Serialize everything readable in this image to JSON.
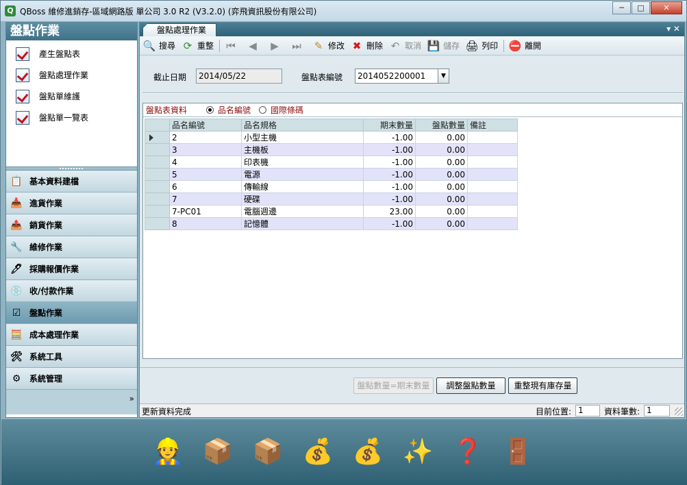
{
  "window": {
    "title": "QBoss 維修進銷存-區域網路版 單公司 3.0 R2 (V3.2.0) (弈飛資訊股份有限公司)",
    "app_icon": "Q",
    "controls": {
      "minimize": "─",
      "maximize": "□",
      "close": "✕"
    }
  },
  "nav": {
    "header": "盤點作業",
    "items": [
      {
        "label": "產生盤點表"
      },
      {
        "label": "盤點處理作業"
      },
      {
        "label": "盤點單維護"
      },
      {
        "label": "盤點單一覽表"
      }
    ],
    "groups": [
      {
        "label": "基本資料建檔",
        "icon": "clipboard-icon",
        "glyph": "📋",
        "active": false
      },
      {
        "label": "進貨作業",
        "icon": "import-doc-icon",
        "glyph": "📥",
        "active": false
      },
      {
        "label": "銷貨作業",
        "icon": "export-doc-icon",
        "glyph": "📤",
        "active": false
      },
      {
        "label": "維修作業",
        "icon": "wrench-icon",
        "glyph": "🔧",
        "active": false
      },
      {
        "label": "採購報價作業",
        "icon": "pen-board-icon",
        "glyph": "🖊",
        "active": false
      },
      {
        "label": "收/付款作業",
        "icon": "disc-icon",
        "glyph": "💿",
        "active": false
      },
      {
        "label": "盤點作業",
        "icon": "checkbox-icon",
        "glyph": "☑",
        "active": true
      },
      {
        "label": "成本處理作業",
        "icon": "calculator-icon",
        "glyph": "🧮",
        "active": false
      },
      {
        "label": "系統工具",
        "icon": "tools-icon",
        "glyph": "🛠",
        "active": false
      },
      {
        "label": "系統管理",
        "icon": "gears-icon",
        "glyph": "⚙",
        "active": false
      }
    ],
    "collapse_glyph": "»"
  },
  "tab": {
    "label": "盤點處理作業",
    "controls": "▾ ✕"
  },
  "toolbar": {
    "search": "搜尋",
    "reorganize": "重整",
    "edit": "修改",
    "delete": "刪除",
    "cancel": "取消",
    "save": "儲存",
    "print": "列印",
    "exit": "離開"
  },
  "filter": {
    "cutoff_label": "截止日期",
    "cutoff_value": "2014/05/22",
    "sheet_no_label": "盤點表編號",
    "sheet_no_value": "2014052200001"
  },
  "grid": {
    "title": "盤點表資料",
    "sort_options": [
      "品名編號",
      "國際條碼"
    ],
    "sort_selected": "品名編號",
    "columns": [
      "品名編號",
      "品名規格",
      "期末數量",
      "盤點數量",
      "備註"
    ],
    "rows": [
      {
        "code": "2",
        "spec": "小型主機",
        "end_qty": "-1.00",
        "count_qty": "0.00",
        "note": ""
      },
      {
        "code": "3",
        "spec": "主機板",
        "end_qty": "-1.00",
        "count_qty": "0.00",
        "note": ""
      },
      {
        "code": "4",
        "spec": "印表機",
        "end_qty": "-1.00",
        "count_qty": "0.00",
        "note": ""
      },
      {
        "code": "5",
        "spec": "電源",
        "end_qty": "-1.00",
        "count_qty": "0.00",
        "note": ""
      },
      {
        "code": "6",
        "spec": "傳輸線",
        "end_qty": "-1.00",
        "count_qty": "0.00",
        "note": ""
      },
      {
        "code": "7",
        "spec": "硬碟",
        "end_qty": "-1.00",
        "count_qty": "0.00",
        "note": ""
      },
      {
        "code": "7-PC01",
        "spec": "電腦週邊",
        "end_qty": "23.00",
        "count_qty": "0.00",
        "note": ""
      },
      {
        "code": "8",
        "spec": "記憶體",
        "end_qty": "-1.00",
        "count_qty": "0.00",
        "note": ""
      }
    ]
  },
  "actions": {
    "set_equal": "盤點數量=期末數量",
    "adjust": "調整盤點數量",
    "rebuild": "重整現有庫存量"
  },
  "status": {
    "message": "更新資料完成",
    "position_label": "目前位置:",
    "position_value": "1",
    "count_label": "資料筆數:",
    "count_value": "1"
  },
  "dock": [
    {
      "icon": "technician-icon",
      "glyph": "👷"
    },
    {
      "icon": "purchase-in-icon",
      "glyph": "📦"
    },
    {
      "icon": "sales-out-icon",
      "glyph": "📦"
    },
    {
      "icon": "coins-in-icon",
      "glyph": "💰"
    },
    {
      "icon": "coins-out-icon",
      "glyph": "💰"
    },
    {
      "icon": "magic-wand-icon",
      "glyph": "✨"
    },
    {
      "icon": "help-doc-icon",
      "glyph": "❓"
    },
    {
      "icon": "exit-door-icon",
      "glyph": "🚪"
    }
  ]
}
